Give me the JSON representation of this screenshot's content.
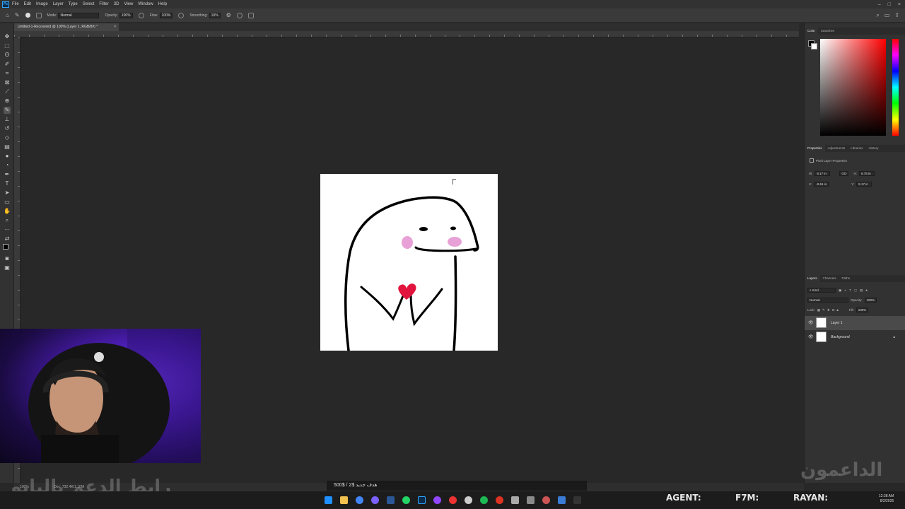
{
  "app": {
    "menu": [
      "File",
      "Edit",
      "Image",
      "Layer",
      "Type",
      "Select",
      "Filter",
      "3D",
      "View",
      "Window",
      "Help"
    ],
    "logo": "Ps"
  },
  "options": {
    "mode_label": "Mode:",
    "mode_value": "Normal",
    "opacity_label": "Opacity:",
    "opacity_value": "100%",
    "flow_label": "Flow:",
    "flow_value": "100%",
    "smoothing_label": "Smoothing:",
    "smoothing_value": "10%"
  },
  "document": {
    "tab_title": "Untitled-1-Recovered @ 100% (Layer 1, RGB/8#) *",
    "close": "×"
  },
  "panels": {
    "color_tabs": [
      "Color",
      "Swatches"
    ],
    "properties_tabs": [
      "Properties",
      "Adjustments",
      "Libraries",
      "History"
    ],
    "properties_title": "Pixel Layer Properties",
    "w_label": "W:",
    "w_value": "8.17 in",
    "h_label": "H:",
    "h_value": "6.78 in",
    "x_label": "X:",
    "x_value": "-0.61 in",
    "y_label": "Y:",
    "y_value": "5.17 in",
    "go_label": "GO",
    "layers_tabs": [
      "Layers",
      "Channels",
      "Paths"
    ],
    "kind_label": "Kind",
    "blend_value": "Normal",
    "opacity_label": "Opacity:",
    "opacity_value": "100%",
    "lock_label": "Lock:",
    "fill_label": "Fill:",
    "fill_value": "100%",
    "layers": [
      {
        "name": "Layer 1",
        "selected": true
      },
      {
        "name": "Background",
        "selected": false
      }
    ]
  },
  "status": {
    "zoom": "100%",
    "doc": "Doc: 732.4K/1.10M"
  },
  "stream": {
    "goal_text": "هدف جديد  $2 / $500",
    "agent_label": "AGENT:",
    "f7m_label": "F7M:",
    "rayan_label": "RAYAN:",
    "support_link_text": "رابط الدعم بالبايو",
    "supporters_text": "الداعمون"
  },
  "taskbar": {
    "time": "12:28 AM",
    "date": "8/2/2026"
  }
}
